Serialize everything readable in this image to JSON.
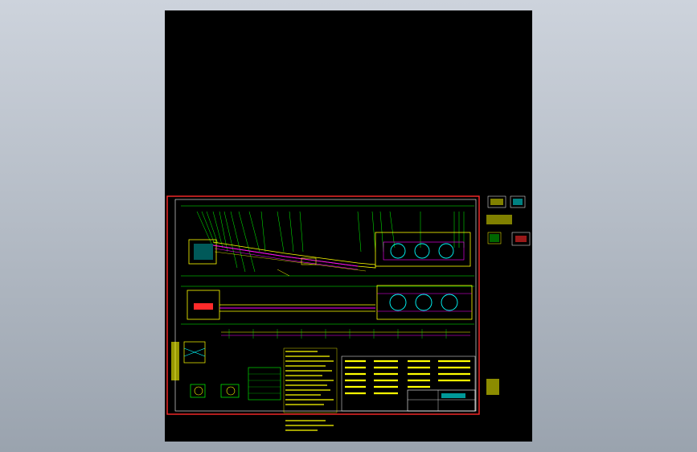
{
  "window": {
    "title": ""
  },
  "drawing": {
    "background_color": "#000000",
    "frame_color": "#ff2a2a",
    "line_color_main": "#ffff00",
    "line_color_secondary": "#00ff00",
    "line_color_accent": "#ff00ff",
    "line_color_cyan": "#00ffff",
    "notes_color": "#ffff00"
  },
  "icons": {
    "zoom": "magnifier-icon",
    "pan": "hand-icon"
  }
}
